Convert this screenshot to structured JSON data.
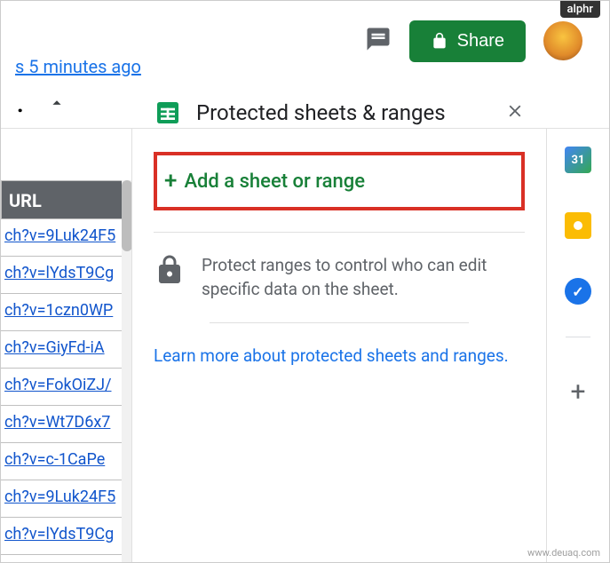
{
  "badge": "alphr",
  "header": {
    "last_edit": "s 5 minutes ago",
    "share_label": "Share"
  },
  "panel": {
    "title": "Protected sheets & ranges",
    "add_label": "Add a sheet or range",
    "info_text": "Protect ranges to control who can edit specific data on the sheet.",
    "learn_more": "Learn more about protected sheets and ranges."
  },
  "sheet": {
    "column_header": "URL",
    "rows": [
      "ch?v=9Luk24F5",
      "ch?v=lYdsT9Cg",
      "ch?v=1czn0WP",
      "ch?v=GiyFd-iA",
      "ch?v=FokOiZJ/",
      "ch?v=Wt7D6x7",
      "ch?v=c-1CaPe",
      "ch?v=9Luk24F5",
      "ch?v=lYdsT9Cg"
    ]
  },
  "rail": {
    "calendar_day": "31",
    "tasks_check": "✓"
  },
  "watermark": "www.deuaq.com"
}
